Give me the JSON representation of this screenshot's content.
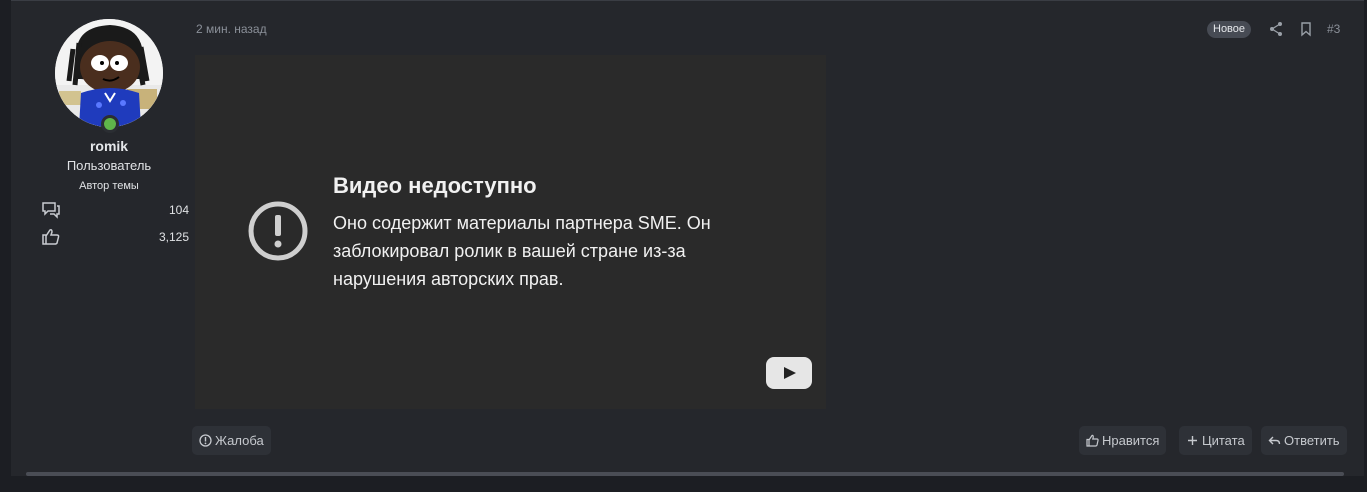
{
  "post": {
    "time": "2 мин. назад",
    "badge_new": "Новое",
    "number": "#3",
    "icons": {
      "share": "share-icon",
      "bookmark": "bookmark-icon"
    }
  },
  "user": {
    "name": "romik",
    "title": "Пользователь",
    "banner": "Автор темы",
    "stats": {
      "messages": "104",
      "reactions": "3,125"
    },
    "online_color": "#5fb54a"
  },
  "video": {
    "title": "Видео недоступно",
    "message": "Оно содержит материалы партнера SME. Он заблокировал ролик в вашей стране из-за нарушения авторских прав."
  },
  "actions": {
    "report": "Жалоба",
    "like": "Нравится",
    "quote": "Цитата",
    "reply": "Ответить"
  }
}
